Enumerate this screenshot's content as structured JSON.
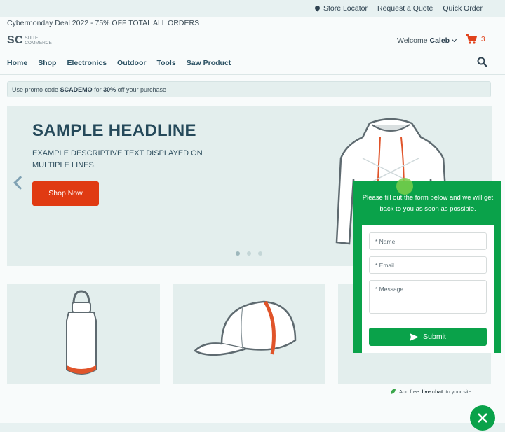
{
  "topbar": {
    "store_locator": "Store Locator",
    "request_quote": "Request a Quote",
    "quick_order": "Quick Order"
  },
  "deal_text": "Cybermonday Deal 2022 - 75% OFF TOTAL ALL ORDERS",
  "logo": {
    "mark": "SC",
    "line1": "SUITE",
    "line2": "COMMERCE"
  },
  "header": {
    "welcome_prefix": "Welcome",
    "user_name": "Caleb",
    "cart_count": "3"
  },
  "nav": {
    "items": [
      "Home",
      "Shop",
      "Electronics",
      "Outdoor",
      "Tools",
      "Saw Product"
    ]
  },
  "promo": {
    "prefix": "Use promo code",
    "code": "SCADEMO",
    "middle": "for",
    "percent": "30%",
    "suffix": "off your purchase"
  },
  "hero": {
    "headline": "SAMPLE HEADLINE",
    "description": "EXAMPLE DESCRIPTIVE TEXT DISPLAYED ON MULTIPLE LINES.",
    "button_label": "Shop Now"
  },
  "chat": {
    "message": "Please fill out the form below and we will get back to you as soon as possible.",
    "name_placeholder": "* Name",
    "email_placeholder": "* Email",
    "message_placeholder": "* Message",
    "submit_label": "Submit",
    "powered_prefix": "Add free",
    "powered_bold": "live chat",
    "powered_suffix": "to your site"
  },
  "colors": {
    "accent_orange": "#e03a12",
    "chat_green": "#0aa24a",
    "nav_blue": "#2b5163"
  }
}
